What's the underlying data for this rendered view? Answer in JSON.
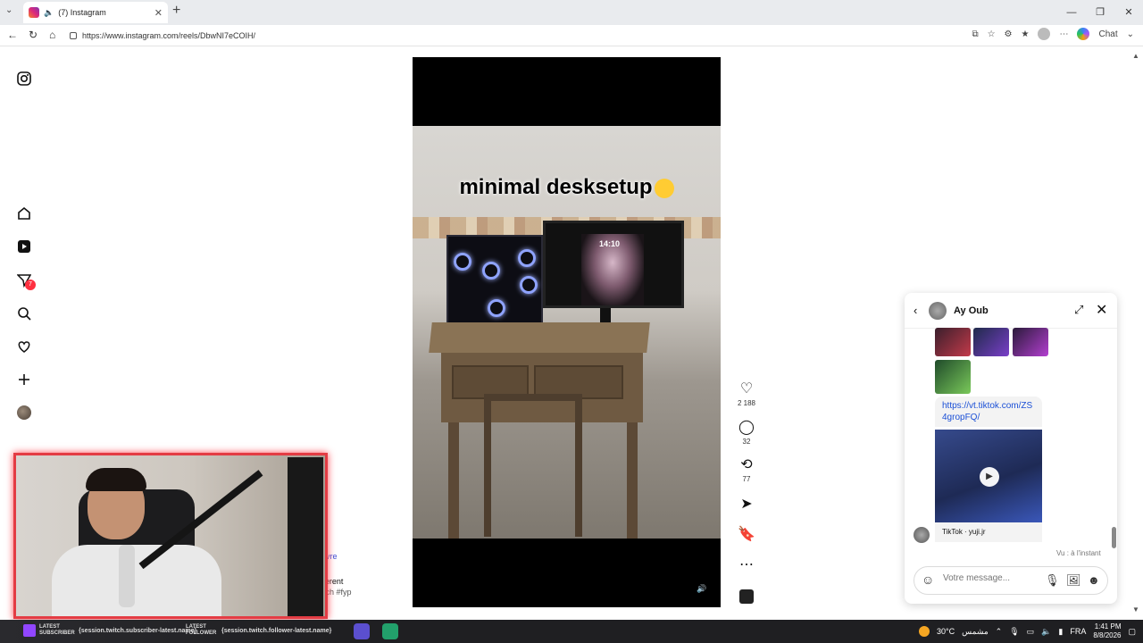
{
  "browser": {
    "tab_title": "(7) Instagram",
    "url": "https://www.instagram.com/reels/DbwNI7eCOIH/",
    "chat_label": "Chat"
  },
  "sidebar": {
    "notification_count": "7"
  },
  "reel": {
    "caption": "minimal desksetup",
    "screen_clock": "14:10",
    "likes": "2 188",
    "comments": "32",
    "reposts": "77"
  },
  "peek_text": {
    "follow": "Suivre",
    "caption_part": "different",
    "hashtags": "#tech #fyp"
  },
  "chat": {
    "contact_name": "Ay Oub",
    "link_text": "https://vt.tiktok.com/ZS4gropFQ/",
    "video_source": "TikTok · yuji.jr",
    "seen_status": "Vu : à l'instant",
    "message_placeholder": "Votre message..."
  },
  "taskbar": {
    "alert1_label": "LATEST SUBSCRIBER",
    "alert1_value": "{session.twitch.subscriber-latest.name}",
    "alert2_label": "LATEST FOLLOWER",
    "alert2_value": "{session.twitch.follower-latest.name}",
    "weather": "30°C",
    "weather_desc": "مشمس",
    "language": "FRA",
    "time": "1:41 PM",
    "date": "8/8/2026"
  },
  "colors": {
    "badge": "#ff3040",
    "webcam_border": "#e33c44",
    "link": "#1a4fd6",
    "taskbar": "#1f1f22"
  },
  "icons": [
    "instagram-logo-icon",
    "home-icon",
    "reels-icon",
    "messages-icon",
    "search-icon",
    "heart-icon",
    "create-icon",
    "like-icon",
    "comment-icon",
    "repost-icon",
    "share-icon",
    "bookmark-icon",
    "more-icon",
    "audio-icon",
    "play-icon",
    "emoji-icon",
    "mic-icon",
    "image-icon",
    "sticker-icon"
  ]
}
